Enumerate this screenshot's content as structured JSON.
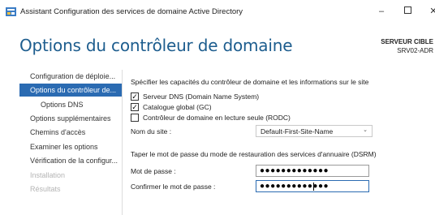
{
  "window": {
    "title": "Assistant Configuration des services de domaine Active Directory",
    "minimize": "–",
    "close": "✕"
  },
  "header": {
    "page_title": "Options du contrôleur de domaine",
    "target_label": "SERVEUR CIBLE",
    "target_value": "SRV02-ADR"
  },
  "sidebar": {
    "items": [
      {
        "label": "Configuration de déploie..."
      },
      {
        "label": "Options du contrôleur de..."
      },
      {
        "label": "Options DNS"
      },
      {
        "label": "Options supplémentaires"
      },
      {
        "label": "Chemins d'accès"
      },
      {
        "label": "Examiner les options"
      },
      {
        "label": "Vérification de la configur..."
      },
      {
        "label": "Installation"
      },
      {
        "label": "Résultats"
      }
    ]
  },
  "capabilities": {
    "heading": "Spécifier les capacités du contrôleur de domaine et les informations sur le site",
    "options": [
      {
        "label": "Serveur DNS (Domain Name System)",
        "checked": true
      },
      {
        "label": "Catalogue global (GC)",
        "checked": true
      },
      {
        "label": "Contrôleur de domaine en lecture seule (RODC)",
        "checked": false
      }
    ],
    "site_label": "Nom du site :",
    "site_value": "Default-First-Site-Name"
  },
  "dsrm": {
    "heading": "Taper le mot de passe du mode de restauration des services d'annuaire (DSRM)",
    "password_label": "Mot de passe :",
    "password_value": "●●●●●●●●●●●●●",
    "confirm_label": "Confirmer le mot de passe :",
    "confirm_value": "●●●●●●●●●●●●●"
  },
  "colors": {
    "accent": "#2b6bb2",
    "title": "#1d5d8e",
    "disabled_text": "#b4b4b4"
  }
}
